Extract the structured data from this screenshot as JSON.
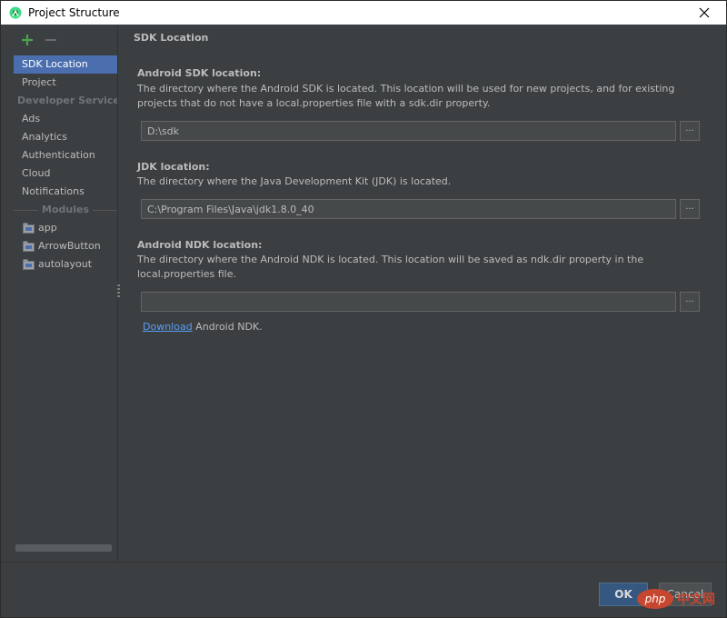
{
  "window": {
    "title": "Project Structure"
  },
  "sidebar": {
    "items": [
      {
        "label": "SDK Location",
        "selected": true
      },
      {
        "label": "Project"
      }
    ],
    "developer_services_header": "Developer Services",
    "services": [
      "Ads",
      "Analytics",
      "Authentication",
      "Cloud",
      "Notifications"
    ],
    "modules_header": "Modules",
    "modules": [
      "app",
      "ArrowButton",
      "autolayout"
    ]
  },
  "main": {
    "section_title": "SDK Location",
    "android_sdk": {
      "label": "Android SDK location:",
      "description": "The directory where the Android SDK is located. This location will be used for new projects, and for existing projects that do not have a local.properties file with a sdk.dir property.",
      "value": "D:\\sdk",
      "browse": "..."
    },
    "jdk": {
      "label": "JDK location:",
      "description": "The directory where the Java Development Kit (JDK) is located.",
      "value": "C:\\Program Files\\Java\\jdk1.8.0_40",
      "browse": "..."
    },
    "ndk": {
      "label": "Android NDK location:",
      "description": "The directory where the Android NDK is located. This location will be saved as ndk.dir property in the local.properties file.",
      "value": "",
      "browse": "...",
      "download_link": "Download",
      "download_suffix": " Android NDK."
    }
  },
  "footer": {
    "ok": "OK",
    "cancel": "Cancel"
  },
  "watermark": {
    "logo": "php",
    "text": "中文网"
  },
  "colors": {
    "selected": "#4b6eaf",
    "link": "#589df6",
    "ok_button": "#365880"
  }
}
